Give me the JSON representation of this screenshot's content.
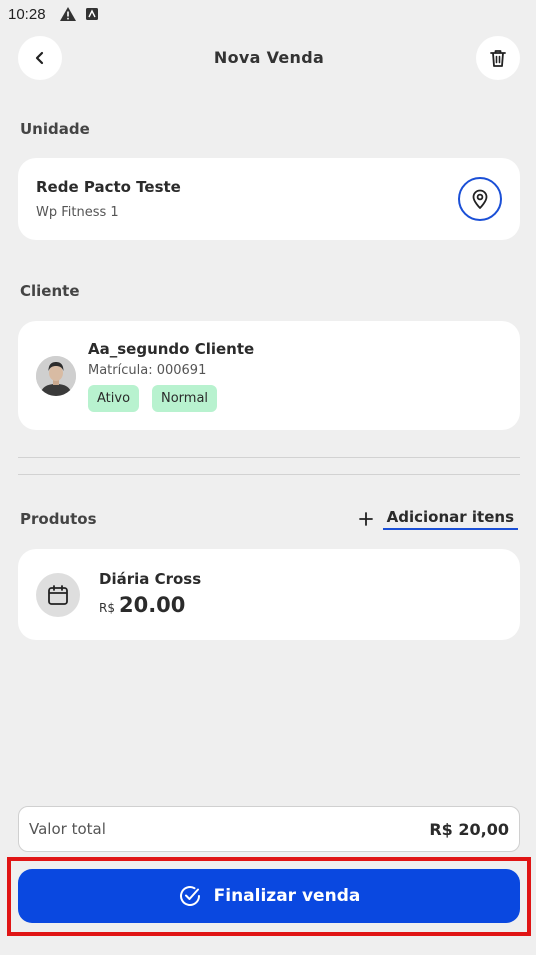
{
  "status_bar": {
    "time": "10:28",
    "icons": [
      "warning-icon",
      "app-notification-icon"
    ]
  },
  "header": {
    "title": "Nova Venda",
    "back_icon": "chevron-left-icon",
    "trash_icon": "trash-icon"
  },
  "unidade": {
    "label": "Unidade",
    "name": "Rede Pacto Teste",
    "subtitle": "Wp Fitness 1",
    "icon": "location-pin-icon"
  },
  "cliente": {
    "label": "Cliente",
    "name": "Aa_segundo Cliente",
    "matricula": "Matrícula: 000691",
    "tags": [
      "Ativo",
      "Normal"
    ]
  },
  "produtos": {
    "label": "Produtos",
    "add_label": "Adicionar itens",
    "items": [
      {
        "name": "Diária Cross",
        "currency": "R$",
        "value": "20.00",
        "icon": "calendar-icon"
      }
    ]
  },
  "total": {
    "label": "Valor total",
    "value": "R$ 20,00"
  },
  "finish": {
    "label": "Finalizar venda",
    "icon": "check-circle-icon"
  },
  "colors": {
    "primary": "#0a48e0",
    "accent_border": "#1a4fd6",
    "tag_bg": "#b8f2cf",
    "highlight": "#e01515",
    "background": "#efefef"
  }
}
